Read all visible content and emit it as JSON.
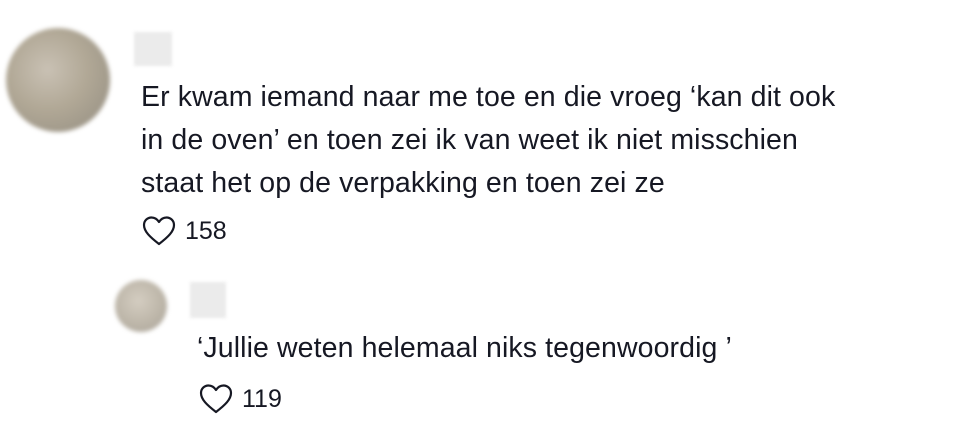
{
  "comments": [
    {
      "text_lines": [
        "Er kwam iemand naar me toe en die vroeg ‘kan dit ook",
        "in de oven’ en toen zei ik van weet ik niet misschien",
        "staat het op de verpakking en toen zei ze"
      ],
      "likes": "158",
      "reply": {
        "text": "‘Jullie weten helemaal niks tegenwoordig ’",
        "likes": "119"
      }
    }
  ],
  "icons": {
    "like": "heart-outline-icon"
  },
  "colors": {
    "text": "#161823",
    "background": "#ffffff"
  }
}
